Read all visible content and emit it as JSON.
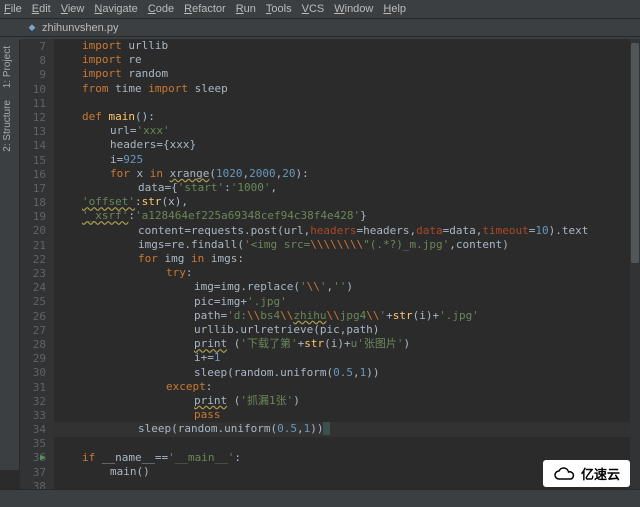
{
  "menu": [
    "File",
    "Edit",
    "View",
    "Navigate",
    "Code",
    "Refactor",
    "Run",
    "Tools",
    "VCS",
    "Window",
    "Help"
  ],
  "tab": {
    "name": "zhihunvshen.py",
    "close": "×"
  },
  "breadcrumb": {
    "name": "zhihunvshen.py"
  },
  "sidetabs": [
    "1: Project",
    "2: Structure"
  ],
  "gutter_start": 7,
  "gutter_end": 38,
  "run_line": 36,
  "caret_line": 34,
  "code_lines": [
    {
      "i": 1,
      "html": "<span class='kw'>import</span> urllib"
    },
    {
      "i": 1,
      "html": "<span class='kw'>import</span> re"
    },
    {
      "i": 1,
      "html": "<span class='kw'>import</span> random"
    },
    {
      "i": 1,
      "html": "<span class='kw'>from</span> time <span class='kw'>import</span> sleep"
    },
    {
      "i": 0,
      "html": ""
    },
    {
      "i": 1,
      "html": "<span class='kw'>def</span> <span class='fn'>main</span>():"
    },
    {
      "i": 2,
      "html": "url=<span class='str'>'xxx'</span>"
    },
    {
      "i": 2,
      "html": "headers={xxx}"
    },
    {
      "i": 2,
      "html": "i=<span class='num'>925</span>"
    },
    {
      "i": 2,
      "html": "<span class='kw'>for</span> x <span class='kw'>in</span> <span class='warn'>xrange</span>(<span class='num'>1020</span>,<span class='num'>2000</span>,<span class='num'>20</span>):"
    },
    {
      "i": 3,
      "html": "data={<span class='str'>'start'</span>:<span class='str'>'1000'</span>,"
    },
    {
      "i": 1,
      "html": "<span class='str warn'>'offset'</span>:<span class='fn'>str</span>(x),"
    },
    {
      "i": 1,
      "html": "<span class='str warn'>'_xsrf'</span>:<span class='str'>'a128464ef225a69348cef94c38f4e428'</span>}"
    },
    {
      "i": 3,
      "html": "content=requests.post(url,<span class='arg'>headers</span>=headers,<span class='arg'>data</span>=data,<span class='arg'>timeout</span>=<span class='num'>10</span>).text"
    },
    {
      "i": 3,
      "html": "imgs=re.findall(<span class='str'>'&lt;img src=</span><span class='kw'>\\\\\\\\\\\\\\\\</span><span class='str'>\"(.*?)_m.jpg'</span>,content)"
    },
    {
      "i": 3,
      "html": "<span class='kw'>for</span> img <span class='kw'>in</span> imgs:"
    },
    {
      "i": 4,
      "html": "<span class='kw'>try</span>:"
    },
    {
      "i": 5,
      "html": "img=img.replace(<span class='str'>'</span><span class='kw'>\\\\</span><span class='str'>'</span>,<span class='str'>''</span>)"
    },
    {
      "i": 5,
      "html": "pic=img+<span class='str'>'.jpg'</span>"
    },
    {
      "i": 5,
      "html": "path=<span class='str'>'d:</span><span class='kw'>\\\\</span><span class='str'>bs4</span><span class='kw'>\\\\</span><span class='str warn'>zhihu</span><span class='kw'>\\\\</span><span class='str'>jpg4</span><span class='kw'>\\\\</span><span class='str'>'</span>+<span class='fn'>str</span>(i)+<span class='str'>'.jpg'</span>"
    },
    {
      "i": 5,
      "html": "urllib.urlretrieve(pic,path)"
    },
    {
      "i": 5,
      "html": "<span class='warn'>print</span> (<span class='str'>'下载了第'</span>+<span class='fn'>str</span>(i)+<span class='str'>u'张图片'</span>)"
    },
    {
      "i": 5,
      "html": "i+=<span class='num'>1</span>"
    },
    {
      "i": 5,
      "html": "sleep(random.uniform(<span class='num'>0.5</span>,<span class='num'>1</span>))"
    },
    {
      "i": 4,
      "html": "<span class='kw'>except</span>:"
    },
    {
      "i": 5,
      "html": "<span class='warn'>print</span> (<span class='str'>'抓漏1张'</span>)"
    },
    {
      "i": 5,
      "html": "<span class='kw'>pass</span>"
    },
    {
      "i": 3,
      "html": "sleep(random.uniform(<span class='num'>0.5</span>,<span class='num'>1</span>))<span style='background:#3b514d'>&nbsp;</span>"
    },
    {
      "i": 0,
      "html": ""
    },
    {
      "i": 1,
      "html": "<span class='kw'>if</span> __name__==<span class='str'>'__main__'</span>:"
    },
    {
      "i": 2,
      "html": "main()"
    },
    {
      "i": 0,
      "html": ""
    }
  ],
  "watermark": "亿速云"
}
